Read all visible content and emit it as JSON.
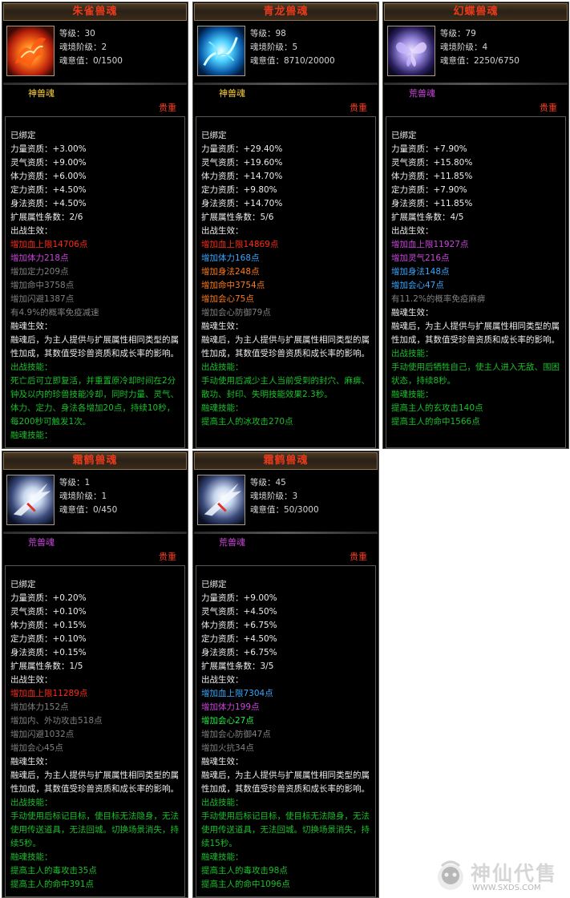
{
  "cards": [
    {
      "title": "朱雀兽魂",
      "level": "等级：30",
      "realm": "魂境阶级：2",
      "will": "魂意值：0/1500",
      "type": "神兽魂",
      "rarity": "贵重",
      "lines": [
        {
          "t": "已绑定",
          "c": "w"
        },
        {
          "t": "力量资质：+3.00%",
          "c": "w"
        },
        {
          "t": "灵气资质：+9.00%",
          "c": "w"
        },
        {
          "t": "体力资质：+6.00%",
          "c": "w"
        },
        {
          "t": "定力资质：+4.50%",
          "c": "w"
        },
        {
          "t": "身法资质：+4.50%",
          "c": "w"
        },
        {
          "t": "扩展属性条数：2/6",
          "c": "w"
        },
        {
          "t": "出战生效：",
          "c": "w"
        },
        {
          "t": "增加血上限14706点",
          "c": "r"
        },
        {
          "t": "增加体力218点",
          "c": "p"
        },
        {
          "t": "增加定力209点",
          "c": "gy"
        },
        {
          "t": "增加命中3758点",
          "c": "gy"
        },
        {
          "t": "增加闪避1387点",
          "c": "gy"
        },
        {
          "t": "有4.9%的概率免疫减速",
          "c": "gy"
        },
        {
          "t": "融魂生效：",
          "c": "w"
        },
        {
          "t": "融魂后，为主人提供与扩展属性相同类型的属性加成，其数值受珍兽资质和成长率的影响。",
          "c": "w",
          "wrap": true
        },
        {
          "t": "出战技能：",
          "c": "g"
        },
        {
          "t": "死亡后可立即复活，并重置原冷却时间在2分钟及以内的珍兽技能冷却，同时力量、灵气、体力、定力、身法各增加20点，持续10秒，每200秒可触发1次。",
          "c": "g",
          "wrap": true
        },
        {
          "t": "融魂技能：",
          "c": "g"
        }
      ]
    },
    {
      "title": "青龙兽魂",
      "level": "等级：98",
      "realm": "魂境阶级：5",
      "will": "魂意值：8710/20000",
      "type": "神兽魂",
      "rarity": "贵重",
      "lines": [
        {
          "t": "已绑定",
          "c": "w"
        },
        {
          "t": "力量资质：+29.40%",
          "c": "w"
        },
        {
          "t": "灵气资质：+19.60%",
          "c": "w"
        },
        {
          "t": "体力资质：+14.70%",
          "c": "w"
        },
        {
          "t": "定力资质：+9.80%",
          "c": "w"
        },
        {
          "t": "身法资质：+14.70%",
          "c": "w"
        },
        {
          "t": "扩展属性条数：5/6",
          "c": "w"
        },
        {
          "t": "出战生效：",
          "c": "w"
        },
        {
          "t": "增加血上限14869点",
          "c": "r"
        },
        {
          "t": "增加体力168点",
          "c": "b"
        },
        {
          "t": "增加身法248点",
          "c": "o"
        },
        {
          "t": "增加命中3754点",
          "c": "o"
        },
        {
          "t": "增加会心75点",
          "c": "o"
        },
        {
          "t": "增加会心防御79点",
          "c": "gy"
        },
        {
          "t": "融魂生效：",
          "c": "w"
        },
        {
          "t": "融魂后，为主人提供与扩展属性相同类型的属性加成，其数值受珍兽资质和成长率的影响。",
          "c": "w",
          "wrap": true
        },
        {
          "t": "出战技能：",
          "c": "g"
        },
        {
          "t": "手动使用后减少主人当前受到的封穴、麻痹、散功、封印、失明技能效果2.3秒。",
          "c": "g",
          "wrap": true
        },
        {
          "t": "融魂技能：",
          "c": "g"
        },
        {
          "t": "提高主人的冰攻击270点",
          "c": "g"
        }
      ]
    },
    {
      "title": "幻蝶兽魂",
      "level": "等级：79",
      "realm": "魂境阶级：4",
      "will": "魂意值：2250/6750",
      "type": "荒兽魂",
      "rarity": "贵重",
      "lines": [
        {
          "t": "已绑定",
          "c": "w"
        },
        {
          "t": "力量资质：+7.90%",
          "c": "w"
        },
        {
          "t": "灵气资质：+15.80%",
          "c": "w"
        },
        {
          "t": "体力资质：+11.85%",
          "c": "w"
        },
        {
          "t": "定力资质：+7.90%",
          "c": "w"
        },
        {
          "t": "身法资质：+11.85%",
          "c": "w"
        },
        {
          "t": "扩展属性条数：4/5",
          "c": "w"
        },
        {
          "t": "出战生效：",
          "c": "w"
        },
        {
          "t": "增加血上限11927点",
          "c": "p"
        },
        {
          "t": "增加灵气216点",
          "c": "p"
        },
        {
          "t": "增加身法148点",
          "c": "b"
        },
        {
          "t": "增加会心47点",
          "c": "b"
        },
        {
          "t": "有11.2%的概率免疫麻痹",
          "c": "gy"
        },
        {
          "t": "融魂生效：",
          "c": "w"
        },
        {
          "t": "融魂后，为主人提供与扩展属性相同类型的属性加成，其数值受珍兽资质和成长率的影响。",
          "c": "w",
          "wrap": true
        },
        {
          "t": "出战技能：",
          "c": "g"
        },
        {
          "t": "手动使用后牺牲自己，使主人进入无敌、围困状态，持续8秒。",
          "c": "g",
          "wrap": true
        },
        {
          "t": "融魂技能：",
          "c": "g"
        },
        {
          "t": "提高主人的玄攻击140点",
          "c": "g"
        },
        {
          "t": "提高主人的命中1566点",
          "c": "g"
        }
      ]
    },
    {
      "title": "霜鹤兽魂",
      "level": "等级：1",
      "realm": "魂境阶级：1",
      "will": "魂意值：0/450",
      "type": "荒兽魂",
      "rarity": "贵重",
      "lines": [
        {
          "t": "已绑定",
          "c": "w"
        },
        {
          "t": "力量资质：+0.20%",
          "c": "w"
        },
        {
          "t": "灵气资质：+0.10%",
          "c": "w"
        },
        {
          "t": "体力资质：+0.15%",
          "c": "w"
        },
        {
          "t": "定力资质：+0.10%",
          "c": "w"
        },
        {
          "t": "身法资质：+0.15%",
          "c": "w"
        },
        {
          "t": "扩展属性条数：1/5",
          "c": "w"
        },
        {
          "t": "出战生效：",
          "c": "w"
        },
        {
          "t": "增加血上限11289点",
          "c": "r"
        },
        {
          "t": "增加体力152点",
          "c": "gy"
        },
        {
          "t": "增加内、外功攻击518点",
          "c": "gy"
        },
        {
          "t": "增加闪避1032点",
          "c": "gy"
        },
        {
          "t": "增加会心45点",
          "c": "gy"
        },
        {
          "t": "融魂生效：",
          "c": "w"
        },
        {
          "t": "融魂后，为主人提供与扩展属性相同类型的属性加成，其数值受珍兽资质和成长率的影响。",
          "c": "w",
          "wrap": true
        },
        {
          "t": "出战技能：",
          "c": "g"
        },
        {
          "t": "手动使用后标记目标，使目标无法隐身，无法使用传送道具，无法回城。切换场景消失，持续5秒。",
          "c": "g",
          "wrap": true
        },
        {
          "t": "融魂技能：",
          "c": "g"
        },
        {
          "t": "提高主人的毒攻击35点",
          "c": "g"
        },
        {
          "t": "提高主人的命中391点",
          "c": "g"
        }
      ]
    },
    {
      "title": "霜鹤兽魂",
      "level": "等级：45",
      "realm": "魂境阶级：3",
      "will": "魂意值：50/3000",
      "type": "荒兽魂",
      "rarity": "贵重",
      "lines": [
        {
          "t": "已绑定",
          "c": "w"
        },
        {
          "t": "力量资质：+9.00%",
          "c": "w"
        },
        {
          "t": "灵气资质：+4.50%",
          "c": "w"
        },
        {
          "t": "体力资质：+6.75%",
          "c": "w"
        },
        {
          "t": "定力资质：+4.50%",
          "c": "w"
        },
        {
          "t": "身法资质：+6.75%",
          "c": "w"
        },
        {
          "t": "扩展属性条数：3/5",
          "c": "w"
        },
        {
          "t": "出战生效：",
          "c": "w"
        },
        {
          "t": "增加血上限7304点",
          "c": "b"
        },
        {
          "t": "增加体力199点",
          "c": "p"
        },
        {
          "t": "增加会心27点",
          "c": "lg"
        },
        {
          "t": "增加会心防御47点",
          "c": "gy"
        },
        {
          "t": "增加火抗34点",
          "c": "gy"
        },
        {
          "t": "融魂生效：",
          "c": "w"
        },
        {
          "t": "融魂后，为主人提供与扩展属性相同类型的属性加成，其数值受珍兽资质和成长率的影响。",
          "c": "w",
          "wrap": true
        },
        {
          "t": "出战技能：",
          "c": "g"
        },
        {
          "t": "手动使用后标记目标，使目标无法隐身，无法使用传送道具，无法回城。切换场景消失，持续15秒。",
          "c": "g",
          "wrap": true
        },
        {
          "t": "融魂技能：",
          "c": "g"
        },
        {
          "t": "提高主人的毒攻击98点",
          "c": "g"
        },
        {
          "t": "提高主人的命中1096点",
          "c": "g"
        }
      ]
    }
  ],
  "colors": {
    "w": "#ececec",
    "g": "#19c02a",
    "r": "#ff2a1a",
    "p": "#cc44dd",
    "b": "#38a8ff",
    "o": "#ff7a1a",
    "gy": "#808080",
    "lg": "#22ee44",
    "title": "#e83a1c",
    "type_divine": "#ffd23a",
    "type_wild": "#cc44dd"
  },
  "icons": [
    "vermilion-bird-icon",
    "azure-dragon-icon",
    "phantom-butterfly-icon",
    "frost-crane-icon",
    "frost-crane-icon"
  ],
  "watermark": {
    "title": "神仙代售",
    "url": "WWW.SXDS.COM"
  }
}
